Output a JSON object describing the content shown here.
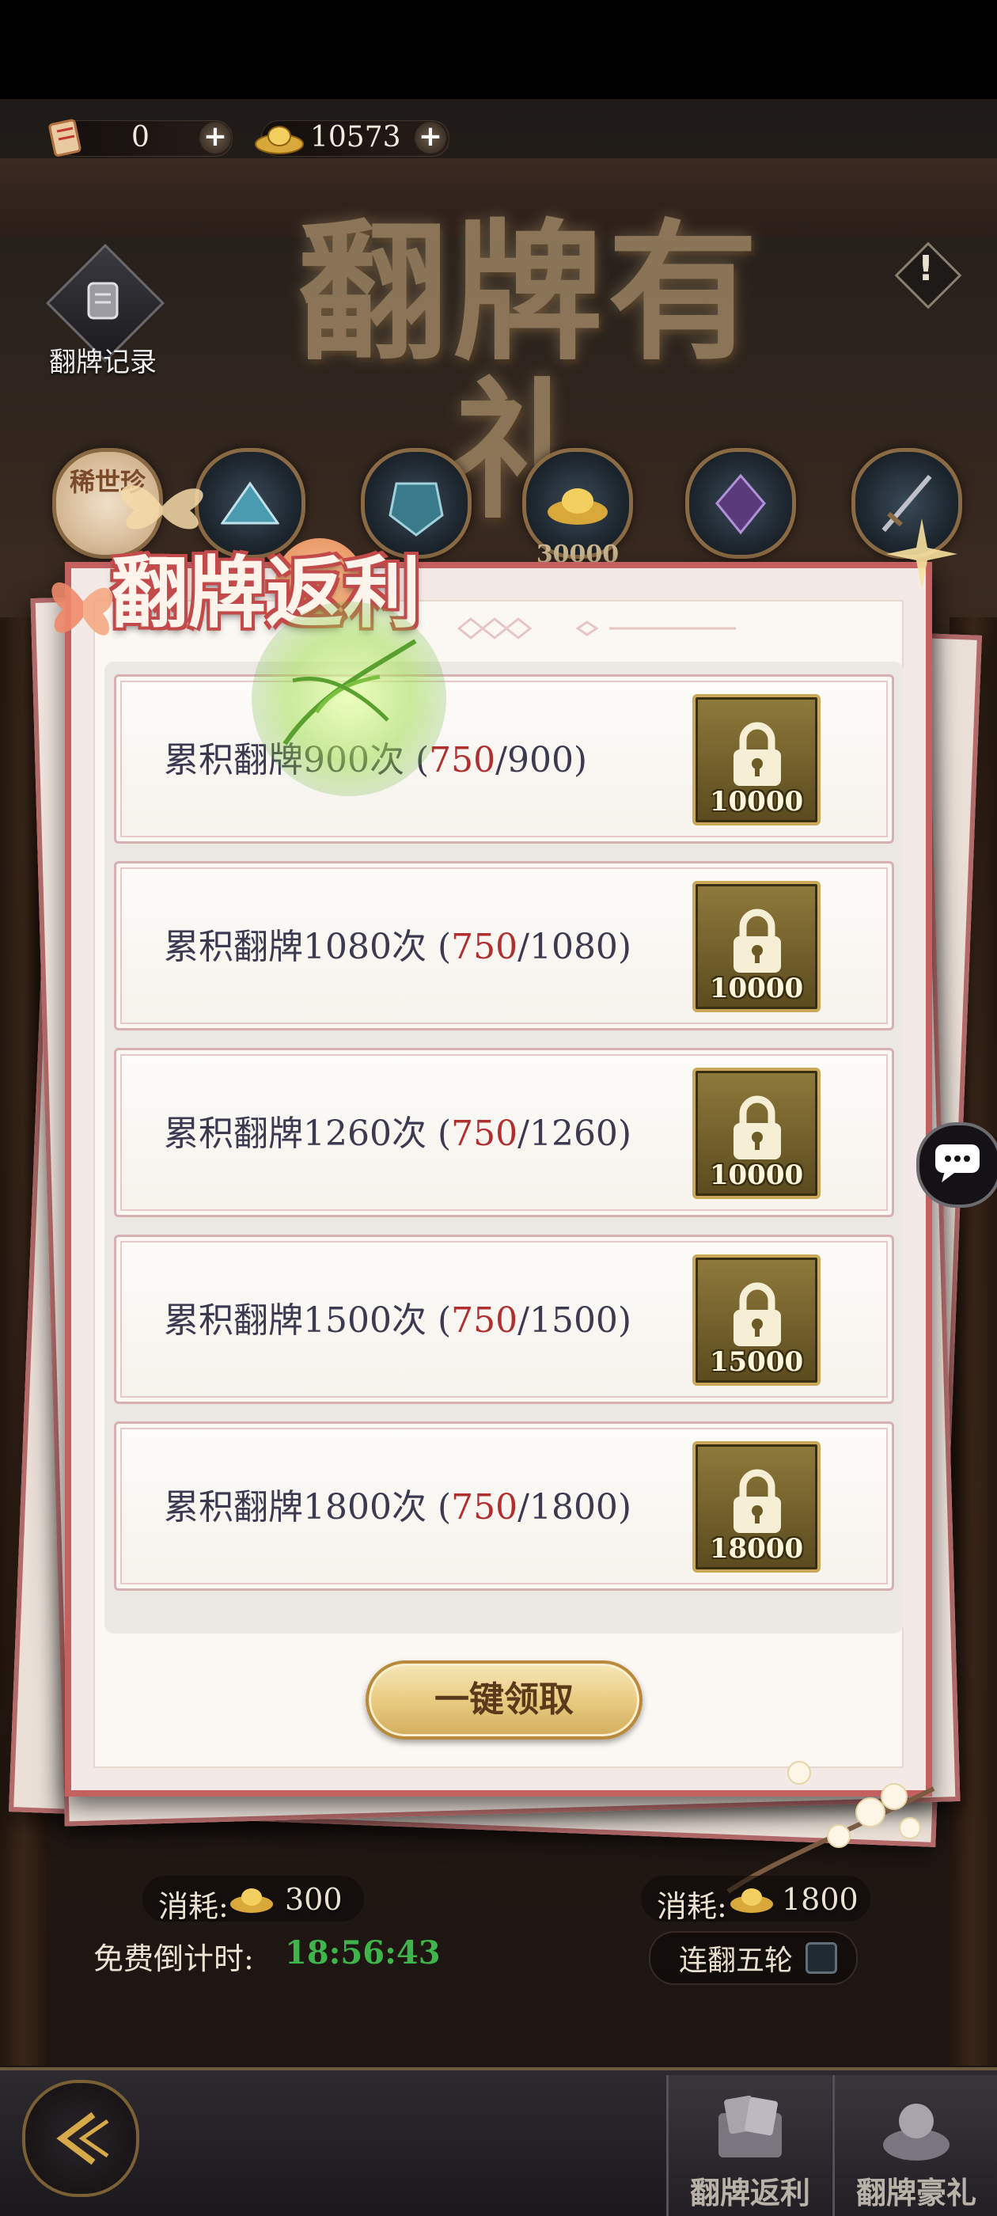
{
  "currency": {
    "tickets": "0",
    "ingots": "10573"
  },
  "header": {
    "title": "翻牌有礼",
    "record_label": "翻牌记录",
    "info_icon": "exclamation-icon",
    "prize_badge_text": "稀世珍",
    "prize_partial_value": "30000"
  },
  "panel": {
    "title": "翻牌返利",
    "tasks": [
      {
        "prefix": "累积翻牌900次 (",
        "current": "750",
        "suffix": "/900)",
        "reward": "10000"
      },
      {
        "prefix": "累积翻牌1080次 (",
        "current": "750",
        "suffix": "/1080)",
        "reward": "10000"
      },
      {
        "prefix": "累积翻牌1260次 (",
        "current": "750",
        "suffix": "/1260)",
        "reward": "10000"
      },
      {
        "prefix": "累积翻牌1500次 (",
        "current": "750",
        "suffix": "/1500)",
        "reward": "15000"
      },
      {
        "prefix": "累积翻牌1800次 (",
        "current": "750",
        "suffix": "/1800)",
        "reward": "18000"
      }
    ],
    "claim_all": "一键领取"
  },
  "footer": {
    "cost_left_label": "消耗:",
    "cost_left_value": "300",
    "cost_right_label": "消耗:",
    "cost_right_value": "1800",
    "timer_label": "免费倒计时:",
    "timer_value": "18:56:43",
    "five_round_label": "连翻五轮"
  },
  "nav": {
    "tab1": "翻牌返利",
    "tab2": "翻牌豪礼"
  },
  "colors": {
    "panel_border": "#c46060",
    "progress_current": "#b03030",
    "timer": "#3fb44a",
    "button_gold": "#e9cc82"
  }
}
